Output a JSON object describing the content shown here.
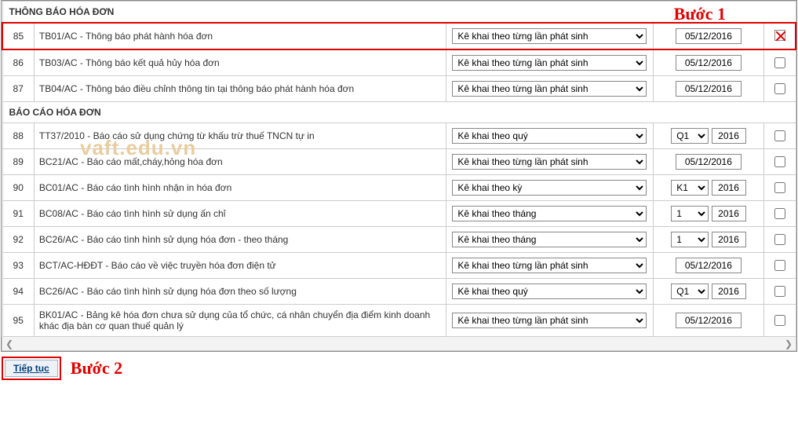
{
  "annotations": {
    "step1": "Bước 1",
    "step2": "Bước 2"
  },
  "watermark": "vaft.edu.vn",
  "buttons": {
    "continue": "Tiếp tục"
  },
  "sections": [
    {
      "title": "THÔNG BÁO HÓA ĐƠN",
      "rows": [
        {
          "num": "85",
          "desc": "TB01/AC - Thông báo phát hành hóa đơn",
          "mode_options": [
            "Kê khai theo từng lần phát sinh"
          ],
          "period_type": "date",
          "date": "05/12/2016",
          "checked": true,
          "highlight": true
        },
        {
          "num": "86",
          "desc": "TB03/AC - Thông báo kết quả hủy hóa đơn",
          "mode_options": [
            "Kê khai theo từng lần phát sinh"
          ],
          "period_type": "date",
          "date": "05/12/2016",
          "checked": false
        },
        {
          "num": "87",
          "desc": "TB04/AC - Thông báo điều chỉnh thông tin tại thông báo phát hành hóa đơn",
          "mode_options": [
            "Kê khai theo từng lần phát sinh"
          ],
          "period_type": "date",
          "date": "05/12/2016",
          "checked": false
        }
      ]
    },
    {
      "title": "BÁO CÁO HÓA ĐƠN",
      "rows": [
        {
          "num": "88",
          "desc": "TT37/2010 - Báo cáo sử dụng chứng từ khấu trừ thuế TNCN tự in",
          "mode_options": [
            "Kê khai theo quý"
          ],
          "period_type": "select_year",
          "period_options": [
            "Q1"
          ],
          "year": "2016",
          "checked": false
        },
        {
          "num": "89",
          "desc": "BC21/AC - Báo cáo mất,cháy,hỏng hóa đơn",
          "mode_options": [
            "Kê khai theo từng lần phát sinh"
          ],
          "period_type": "date",
          "date": "05/12/2016",
          "checked": false
        },
        {
          "num": "90",
          "desc": "BC01/AC - Báo cáo tình hình nhận in hóa đơn",
          "mode_options": [
            "Kê khai theo kỳ"
          ],
          "period_type": "select_year",
          "period_options": [
            "K1"
          ],
          "year": "2016",
          "checked": false
        },
        {
          "num": "91",
          "desc": "BC08/AC - Báo cáo tình hình sử dụng ấn chỉ",
          "mode_options": [
            "Kê khai theo tháng"
          ],
          "period_type": "select_year",
          "period_options": [
            "1"
          ],
          "year": "2016",
          "checked": false
        },
        {
          "num": "92",
          "desc": "BC26/AC - Báo cáo tình hình sử dụng hóa đơn - theo tháng",
          "mode_options": [
            "Kê khai theo tháng"
          ],
          "period_type": "select_year",
          "period_options": [
            "1"
          ],
          "year": "2016",
          "checked": false
        },
        {
          "num": "93",
          "desc": "BCT/AC-HĐĐT - Báo cáo về việc truyền hóa đơn điện tử",
          "mode_options": [
            "Kê khai theo từng lần phát sinh"
          ],
          "period_type": "date",
          "date": "05/12/2016",
          "checked": false
        },
        {
          "num": "94",
          "desc": "BC26/AC - Báo cáo tình hình sử dụng hóa đơn theo số lượng",
          "mode_options": [
            "Kê khai theo quý"
          ],
          "period_type": "select_year",
          "period_options": [
            "Q1"
          ],
          "year": "2016",
          "checked": false
        },
        {
          "num": "95",
          "desc": "BK01/AC - Bảng kê hóa đơn chưa sử dụng của tổ chức, cá nhân chuyển địa điểm kinh doanh khác địa bàn cơ quan thuế quản lý",
          "mode_options": [
            "Kê khai theo từng lần phát sinh"
          ],
          "period_type": "date",
          "date": "05/12/2016",
          "checked": false
        }
      ]
    }
  ]
}
